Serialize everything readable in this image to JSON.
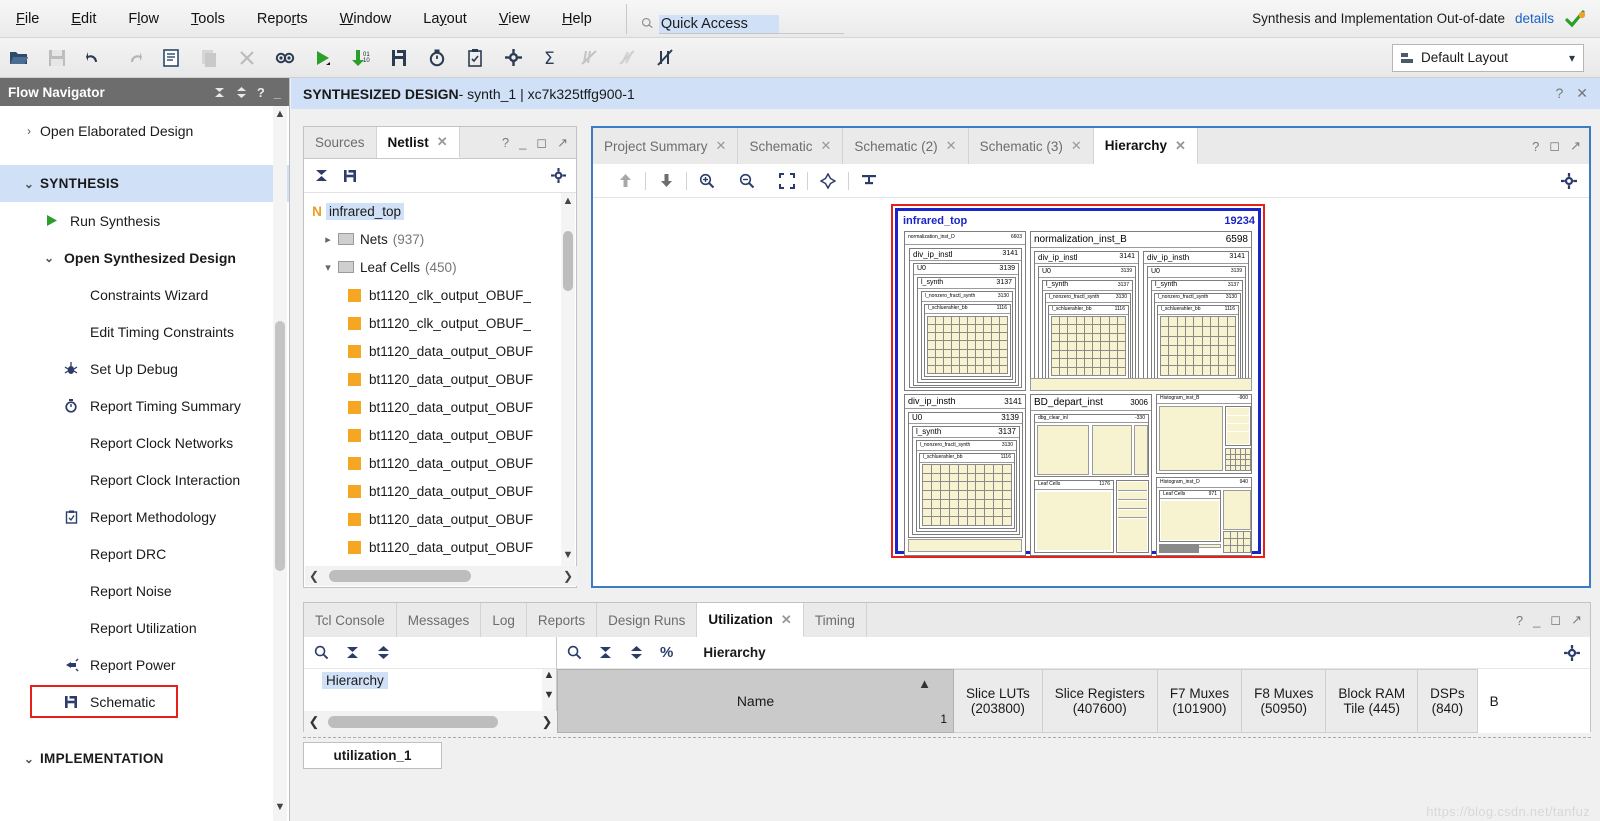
{
  "menu": {
    "items": [
      "File",
      "Edit",
      "Flow",
      "Tools",
      "Reports",
      "Window",
      "Layout",
      "View",
      "Help"
    ]
  },
  "quick_access": {
    "value": "Quick Access",
    "placeholder": "Quick Access",
    "icon": "search-icon"
  },
  "status": {
    "message": "Synthesis and Implementation Out-of-date",
    "details_link": "details"
  },
  "toolbar": {
    "layout_label": "Default Layout",
    "icons": [
      "open-project-icon",
      "save-icon",
      "undo-icon",
      "redo-icon",
      "report-icon",
      "copy-icon",
      "close-icon",
      "search-find-icon",
      "run-synthesis-icon",
      "run-implementation-icon",
      "schematic-icon",
      "timing-icon",
      "checklist-icon",
      "settings-gear-icon",
      "sigma-icon",
      "power-icon",
      "noise-icon",
      "cancel-icon"
    ]
  },
  "flow_navigator": {
    "title": "Flow Navigator",
    "items": [
      {
        "label": "Open Elaborated Design",
        "indent": 0,
        "arrow": "›",
        "icon": "",
        "style": ""
      },
      {
        "label": "SYNTHESIS",
        "indent": 0,
        "arrow": "⌄",
        "icon": "",
        "style": "section"
      },
      {
        "label": "Run Synthesis",
        "indent": 1,
        "arrow": "",
        "icon": "play-icon",
        "style": ""
      },
      {
        "label": "Open Synthesized Design",
        "indent": 1,
        "arrow": "⌄",
        "icon": "",
        "style": "bold"
      },
      {
        "label": "Constraints Wizard",
        "indent": 2,
        "arrow": "",
        "icon": "",
        "style": ""
      },
      {
        "label": "Edit Timing Constraints",
        "indent": 2,
        "arrow": "",
        "icon": "",
        "style": ""
      },
      {
        "label": "Set Up Debug",
        "indent": 2,
        "arrow": "",
        "icon": "bug-icon",
        "style": ""
      },
      {
        "label": "Report Timing Summary",
        "indent": 2,
        "arrow": "",
        "icon": "clock-icon",
        "style": ""
      },
      {
        "label": "Report Clock Networks",
        "indent": 2,
        "arrow": "",
        "icon": "",
        "style": ""
      },
      {
        "label": "Report Clock Interaction",
        "indent": 2,
        "arrow": "",
        "icon": "",
        "style": ""
      },
      {
        "label": "Report Methodology",
        "indent": 2,
        "arrow": "",
        "icon": "clipboard-icon",
        "style": ""
      },
      {
        "label": "Report DRC",
        "indent": 2,
        "arrow": "",
        "icon": "",
        "style": ""
      },
      {
        "label": "Report Noise",
        "indent": 2,
        "arrow": "",
        "icon": "",
        "style": ""
      },
      {
        "label": "Report Utilization",
        "indent": 2,
        "arrow": "",
        "icon": "",
        "style": ""
      },
      {
        "label": "Report Power",
        "indent": 2,
        "arrow": "",
        "icon": "power-plug-icon",
        "style": ""
      },
      {
        "label": "Schematic",
        "indent": 2,
        "arrow": "",
        "icon": "schematic-icon",
        "style": "highlighted"
      },
      {
        "label": "IMPLEMENTATION",
        "indent": 0,
        "arrow": "⌄",
        "icon": "",
        "style": "section"
      }
    ]
  },
  "design_bar": {
    "title_bold": "SYNTHESIZED DESIGN",
    "title_rest": " - synth_1 | xc7k325tffg900-1"
  },
  "netlist_panel": {
    "tabs": [
      {
        "label": "Sources",
        "active": false,
        "closable": false
      },
      {
        "label": "Netlist",
        "active": true,
        "closable": true
      }
    ],
    "tree": {
      "root": {
        "label": "infrared_top",
        "badge": "N"
      },
      "nets": {
        "label": "Nets",
        "count": "(937)"
      },
      "leaf_cells": {
        "label": "Leaf Cells",
        "count": "(450)"
      },
      "cells": [
        "bt1120_clk_output_OBUF_",
        "bt1120_clk_output_OBUF_",
        "bt1120_data_output_OBUF",
        "bt1120_data_output_OBUF",
        "bt1120_data_output_OBUF",
        "bt1120_data_output_OBUF",
        "bt1120_data_output_OBUF",
        "bt1120_data_output_OBUF",
        "bt1120_data_output_OBUF",
        "bt1120_data_output_OBUF"
      ]
    }
  },
  "hierarchy_panel": {
    "tabs": [
      {
        "label": "Project Summary",
        "active": false,
        "closable": true
      },
      {
        "label": "Schematic",
        "active": false,
        "closable": true
      },
      {
        "label": "Schematic (2)",
        "active": false,
        "closable": true
      },
      {
        "label": "Schematic (3)",
        "active": false,
        "closable": true
      },
      {
        "label": "Hierarchy",
        "active": true,
        "closable": true
      }
    ],
    "tools": [
      "up-arrow-icon",
      "down-arrow-icon",
      "zoom-in-icon",
      "zoom-out-icon",
      "zoom-fit-icon",
      "zoom-area-icon",
      "collapse-icon"
    ],
    "diagram": {
      "top": {
        "name": "infrared_top",
        "value": "19234"
      },
      "blocks": [
        {
          "name": "normalization_inst_D",
          "value": "6603"
        },
        {
          "name": "normalization_inst_B",
          "value": "6598"
        },
        {
          "name": "div_ip_instl",
          "value": "3141"
        },
        {
          "name": "U0",
          "value": "3139"
        },
        {
          "name": "l_synth",
          "value": "3137"
        },
        {
          "name": "l_nonzero_fractl_synth",
          "value": "3130"
        },
        {
          "name": "l_schluerahler_bb",
          "value": "1116"
        },
        {
          "name": "div_ip_insth",
          "value": "3141"
        },
        {
          "name": "BD_depart_inst",
          "value": "3006"
        },
        {
          "name": "Histogram_inst_D",
          "value": "940"
        },
        {
          "name": "Leaf Cells",
          "value": "1176"
        }
      ]
    }
  },
  "bottom_panel": {
    "tabs": [
      {
        "label": "Tcl Console",
        "active": false,
        "closable": false
      },
      {
        "label": "Messages",
        "active": false,
        "closable": false
      },
      {
        "label": "Log",
        "active": false,
        "closable": false
      },
      {
        "label": "Reports",
        "active": false,
        "closable": false
      },
      {
        "label": "Design Runs",
        "active": false,
        "closable": false
      },
      {
        "label": "Utilization",
        "active": true,
        "closable": true
      },
      {
        "label": "Timing",
        "active": false,
        "closable": false
      }
    ],
    "left_tools": [
      "search-icon",
      "collapse-all-icon",
      "expand-all-icon"
    ],
    "right_tools": [
      "search-icon",
      "collapse-all-icon",
      "expand-all-icon",
      "percent-icon"
    ],
    "right_label": "Hierarchy",
    "left_list_item": "Hierarchy",
    "table": {
      "row_number": "1",
      "columns": [
        {
          "title": "Name",
          "sub": ""
        },
        {
          "title": "Slice LUTs",
          "sub": "(203800)"
        },
        {
          "title": "Slice Registers",
          "sub": "(407600)"
        },
        {
          "title": "F7 Muxes",
          "sub": "(101900)"
        },
        {
          "title": "F8 Muxes",
          "sub": "(50950)"
        },
        {
          "title": "Block RAM",
          "sub": "Tile (445)"
        },
        {
          "title": "DSPs",
          "sub": "(840)"
        },
        {
          "title": "B",
          "sub": ""
        }
      ]
    },
    "report_tab": "utilization_1"
  },
  "watermark": "https://blog.csdn.net/tanfuz",
  "colors": {
    "accent_blue": "#3b7cc4",
    "selection_blue": "#cfe0f7",
    "highlight_red": "#e8201a",
    "orange_cell": "#f5a623",
    "diagram_fill": "#f7f2cf"
  }
}
